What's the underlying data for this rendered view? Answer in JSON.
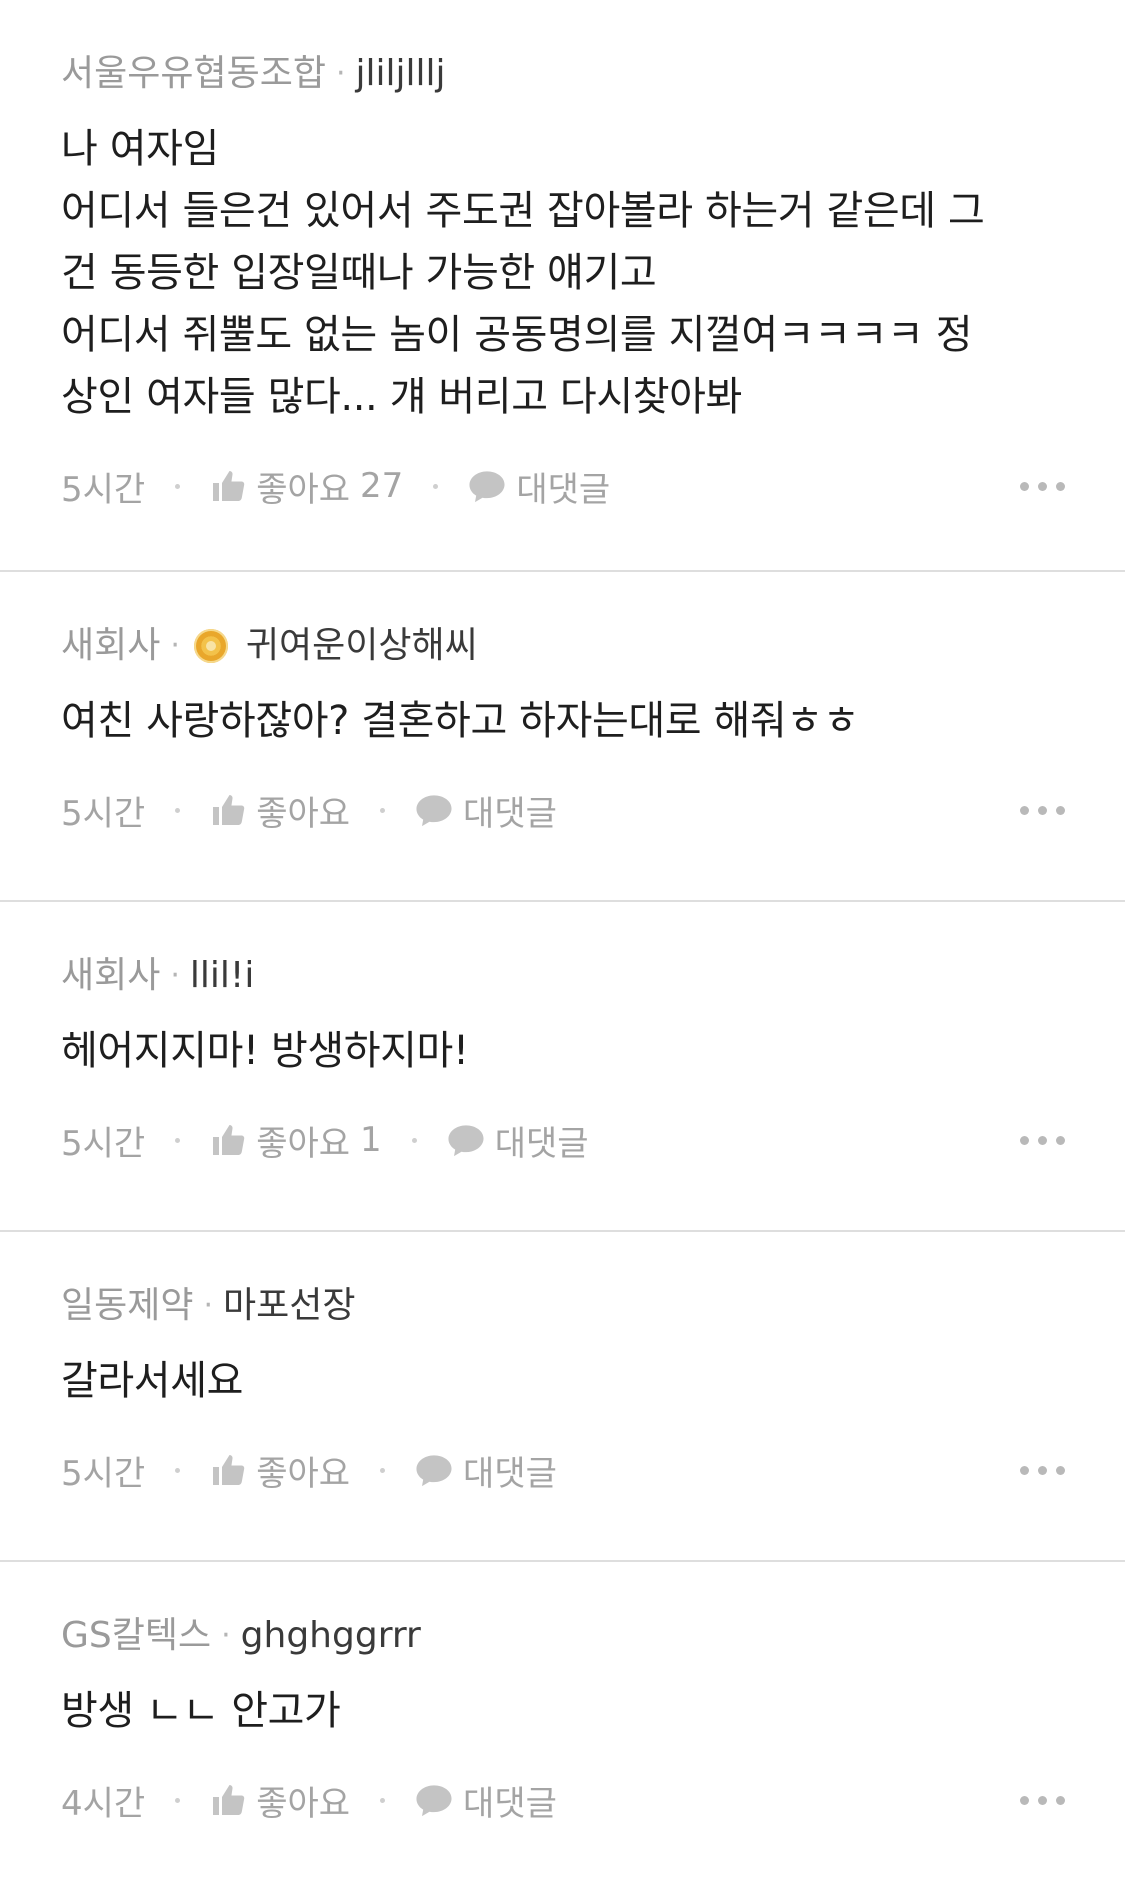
{
  "comments": [
    {
      "company": "서울우유협동조합",
      "nickname": "jliljlllj",
      "badge_icon": "",
      "body": [
        "나 여자임",
        "어디서 들은건 있어서 주도권 잡아볼라 하는거 같은데 그",
        "건 동등한 입장일때나 가능한 얘기고",
        "어디서 쥐뿔도 없는 놈이 공동명의를 지껄여ㅋㅋㅋㅋ 정",
        "상인 여자들 많다... 걔 버리고 다시찾아봐"
      ],
      "time": "5시간",
      "like_label": "좋아요",
      "like_count": "27",
      "reply_label": "대댓글"
    },
    {
      "company": "새회사",
      "nickname": "귀여운이상해씨",
      "badge_icon": "gold-badge-icon",
      "body": [
        "여친 사랑하잖아? 결혼하고 하자는대로 해줘ㅎㅎ"
      ],
      "time": "5시간",
      "like_label": "좋아요",
      "like_count": "",
      "reply_label": "대댓글"
    },
    {
      "company": "새회사",
      "nickname": "llil!i",
      "badge_icon": "",
      "body": [
        "헤어지지마! 방생하지마!"
      ],
      "time": "5시간",
      "like_label": "좋아요",
      "like_count": "1",
      "reply_label": "대댓글"
    },
    {
      "company": "일동제약",
      "nickname": "마포선장",
      "badge_icon": "",
      "body": [
        "갈라서세요"
      ],
      "time": "5시간",
      "like_label": "좋아요",
      "like_count": "",
      "reply_label": "대댓글"
    },
    {
      "company": "GS칼텍스",
      "nickname": "ghghggrrr",
      "badge_icon": "",
      "body": [
        "방생 ㄴㄴ 안고가"
      ],
      "time": "4시간",
      "like_label": "좋아요",
      "like_count": "",
      "reply_label": "대댓글"
    }
  ],
  "colors": {
    "text_primary": "#1e1e1e",
    "text_muted": "#9a9a9a",
    "divider": "#dedede",
    "badge": "#f3c24a"
  }
}
